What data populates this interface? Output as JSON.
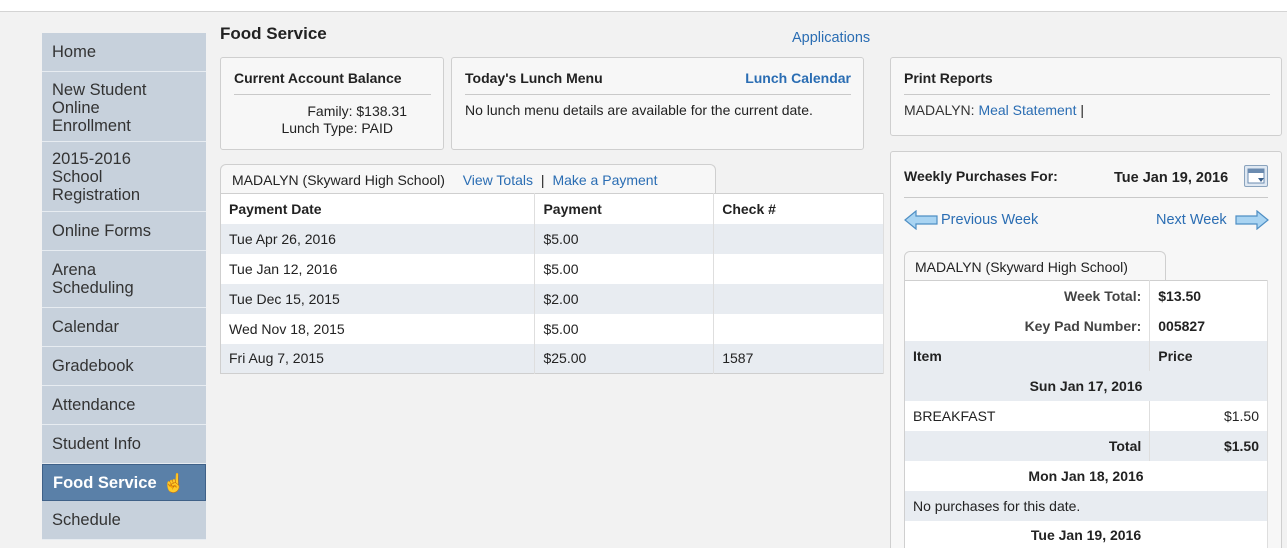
{
  "sidebar": {
    "items": [
      {
        "label": "Home"
      },
      {
        "label": "New Student Online Enrollment"
      },
      {
        "label": "2015-2016 School Registration"
      },
      {
        "label": "Online Forms"
      },
      {
        "label": "Arena Scheduling"
      },
      {
        "label": "Calendar"
      },
      {
        "label": "Gradebook"
      },
      {
        "label": "Attendance"
      },
      {
        "label": "Student Info"
      },
      {
        "label": "Food Service"
      },
      {
        "label": "Schedule"
      }
    ],
    "active": "Food Service"
  },
  "header": {
    "title": "Food Service",
    "applications_link": "Applications"
  },
  "balance": {
    "title": "Current Account Balance",
    "family_label": "Family:",
    "family_value": "$138.31",
    "lunch_type_label": "Lunch Type:",
    "lunch_type_value": "PAID"
  },
  "lunch_menu": {
    "title": "Today's Lunch Menu",
    "calendar_link": "Lunch Calendar",
    "message": "No lunch menu details are available for the current date."
  },
  "print_reports": {
    "title": "Print Reports",
    "student": "MADALYN:",
    "link": "Meal Statement",
    "separator": "|"
  },
  "payments": {
    "tab_label": "MADALYN (Skyward High School)",
    "view_totals": "View Totals",
    "separator": "|",
    "make_payment": "Make a Payment",
    "columns": [
      "Payment Date",
      "Payment",
      "Check #"
    ],
    "rows": [
      {
        "date": "Tue Apr 26, 2016",
        "payment": "$5.00",
        "check": ""
      },
      {
        "date": "Tue Jan 12, 2016",
        "payment": "$5.00",
        "check": ""
      },
      {
        "date": "Tue Dec 15, 2015",
        "payment": "$2.00",
        "check": ""
      },
      {
        "date": "Wed Nov 18, 2015",
        "payment": "$5.00",
        "check": ""
      },
      {
        "date": "Fri Aug 7, 2015",
        "payment": "$25.00",
        "check": "1587"
      }
    ]
  },
  "weekly": {
    "title": "Weekly Purchases For:",
    "date": "Tue Jan 19, 2016",
    "prev": "Previous Week",
    "next": "Next Week",
    "tab_label": "MADALYN (Skyward High School)",
    "week_total_label": "Week Total:",
    "week_total_value": "$13.50",
    "keypad_label": "Key Pad Number:",
    "keypad_value": "005827",
    "col_item": "Item",
    "col_price": "Price",
    "day1": "Sun Jan 17, 2016",
    "day1_item": "BREAKFAST",
    "day1_price": "$1.50",
    "total_label": "Total",
    "day1_total": "$1.50",
    "day2": "Mon Jan 18, 2016",
    "no_purchases": "No purchases for this date.",
    "day3": "Tue Jan 19, 2016"
  },
  "colors": {
    "link": "#2a6db3",
    "nav_bg": "#c7d1dc",
    "nav_active": "#5a80a8",
    "row_shade": "#e8ecf1"
  }
}
